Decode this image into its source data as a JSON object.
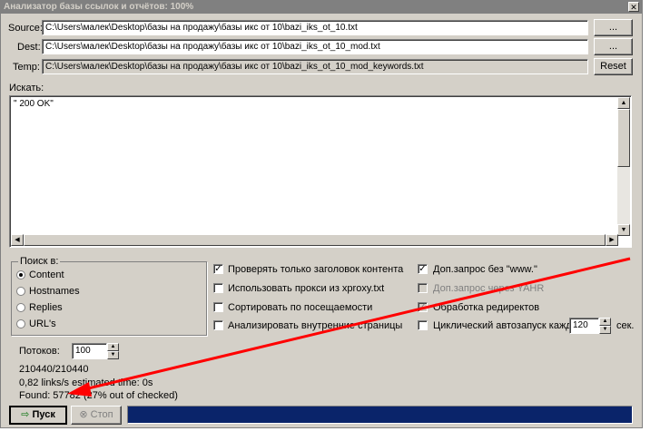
{
  "window": {
    "title": "Анализатор базы ссылок и отчётов: 100%",
    "close_label": "✕"
  },
  "paths": {
    "source_label": "Source:",
    "source_value": "C:\\Users\\малек\\Desktop\\базы на продажу\\базы икс от 10\\bazi_iks_ot_10.txt",
    "dest_label": "Dest:",
    "dest_value": "C:\\Users\\малек\\Desktop\\базы на продажу\\базы икс от 10\\bazi_iks_ot_10_mod.txt",
    "temp_label": "Temp:",
    "temp_value": "C:\\Users\\малек\\Desktop\\базы на продажу\\базы икс от 10\\bazi_iks_ot_10_mod_keywords.txt",
    "browse_label": "...",
    "reset_label": "Reset"
  },
  "search": {
    "label": "Искать:",
    "text": "\" 200 OK\""
  },
  "search_in": {
    "title": "Поиск в:",
    "options": [
      "Content",
      "Hostnames",
      "Replies",
      "URL's"
    ],
    "selected": "Content"
  },
  "options_col1": [
    {
      "label": "Проверять только заголовок контента",
      "checked": true
    },
    {
      "label": "Использовать прокси из xproxy.txt",
      "checked": false
    },
    {
      "label": "Сортировать по посещаемости",
      "checked": false
    },
    {
      "label": "Анализировать внутренние страницы",
      "checked": false
    }
  ],
  "options_col2": [
    {
      "label": "Доп.запрос без \"www.\"",
      "checked": true,
      "enabled": true
    },
    {
      "label": "Доп.запрос через YAHR",
      "checked": false,
      "enabled": false
    },
    {
      "label": "Обработка редиректов",
      "checked": true,
      "enabled": false
    },
    {
      "label": "Циклический автозапуск каждые",
      "checked": false,
      "enabled": true
    }
  ],
  "autorun": {
    "value": "120",
    "unit": "сек."
  },
  "threads": {
    "label": "Потоков:",
    "value": "100"
  },
  "stats": {
    "progress_count": "210440/210440",
    "speed": "0,82 links/s   estimated time: 0s",
    "found": "Found: 57782 (27% out of checked)"
  },
  "buttons": {
    "start": "Пуск",
    "stop": "Стоп"
  },
  "progress_fraction": 1.0,
  "colors": {
    "progress": "#0a246a",
    "arrow": "#ff0000",
    "face": "#d4d0c8"
  }
}
